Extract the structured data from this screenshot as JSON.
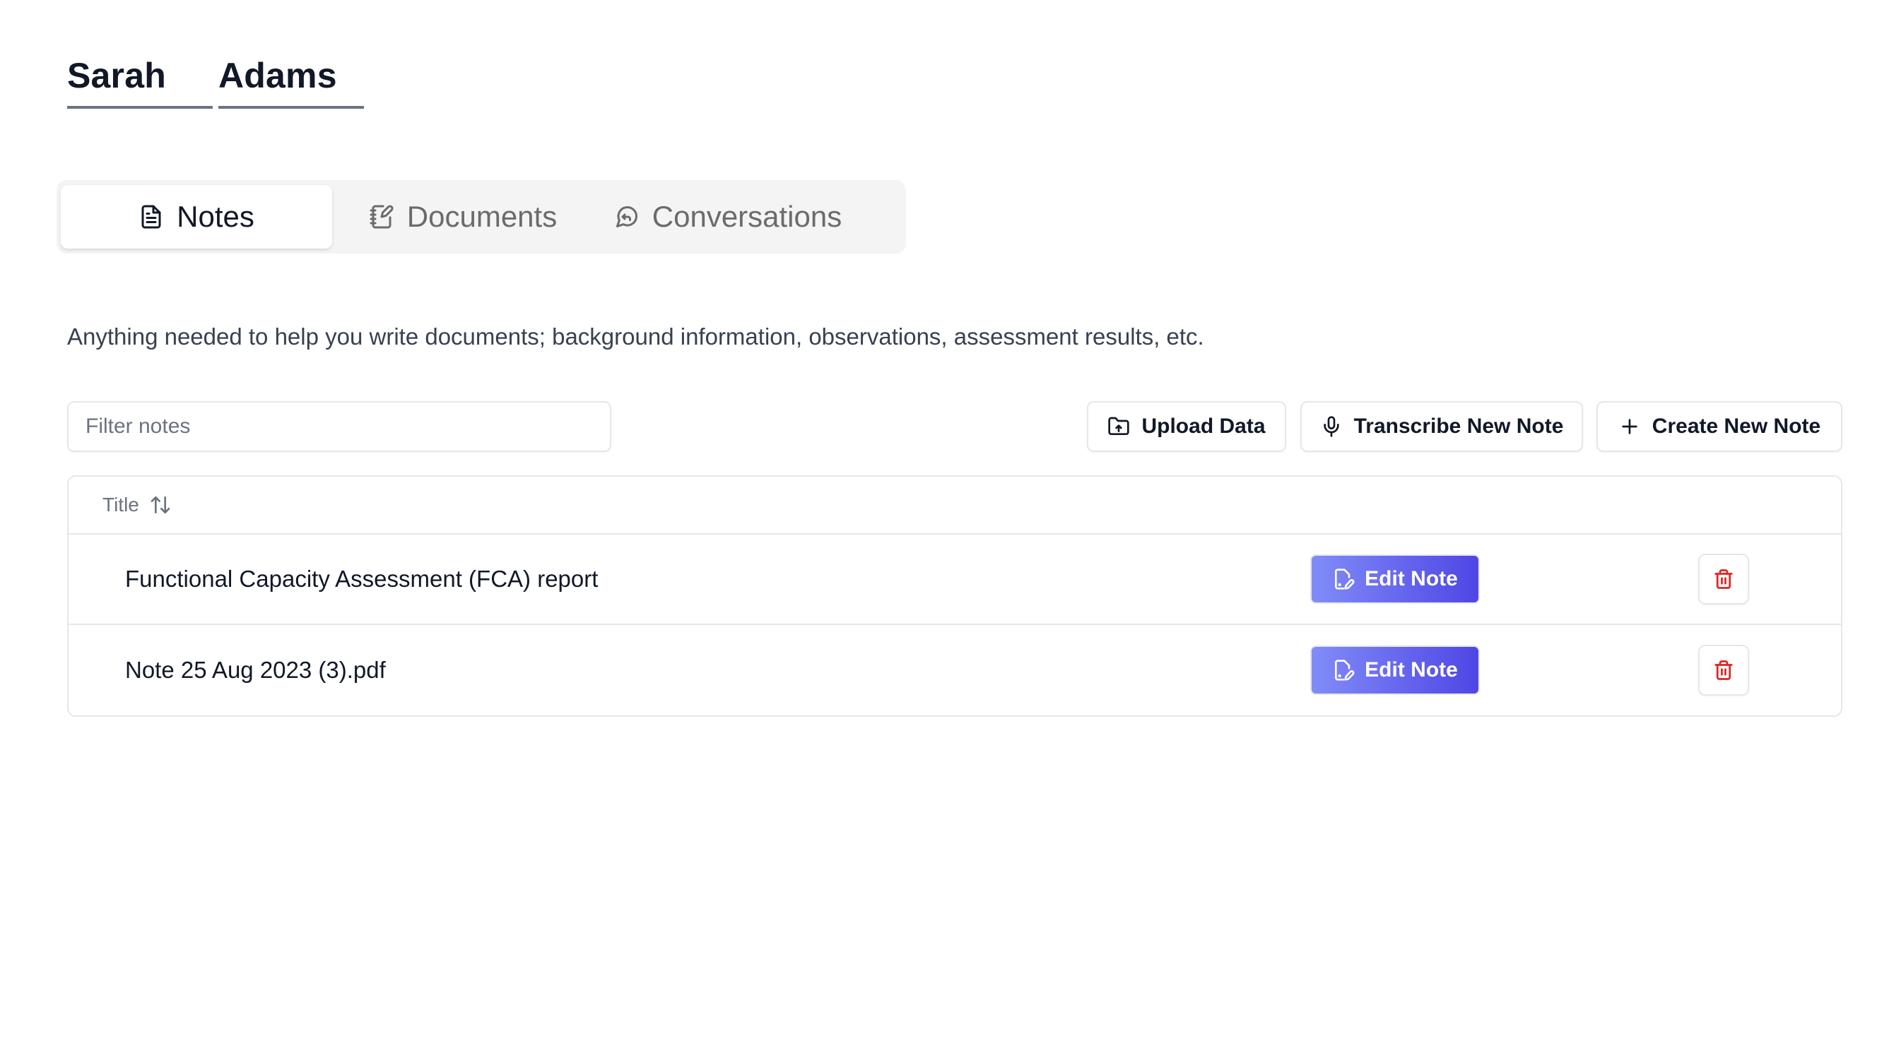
{
  "person": {
    "first_name": "Sarah",
    "last_name": "Adams"
  },
  "tabs": [
    {
      "label": "Notes",
      "icon": "file-text-icon",
      "active": true
    },
    {
      "label": "Documents",
      "icon": "notebook-pen-icon",
      "active": false
    },
    {
      "label": "Conversations",
      "icon": "chat-reply-icon",
      "active": false
    }
  ],
  "description": "Anything needed to help you write documents; background information, observations, assessment results, etc.",
  "filter": {
    "placeholder": "Filter notes",
    "value": ""
  },
  "toolbar": {
    "upload_label": "Upload Data",
    "transcribe_label": "Transcribe New Note",
    "create_label": "Create New Note"
  },
  "table": {
    "header_title": "Title",
    "rows": [
      {
        "title": "Functional Capacity Assessment (FCA) report",
        "edit_label": "Edit Note"
      },
      {
        "title": "Note 25 Aug 2023 (3).pdf",
        "edit_label": "Edit Note"
      }
    ]
  },
  "colors": {
    "accent_start": "#818cf8",
    "accent_end": "#4f46e5",
    "danger": "#dc2626"
  }
}
